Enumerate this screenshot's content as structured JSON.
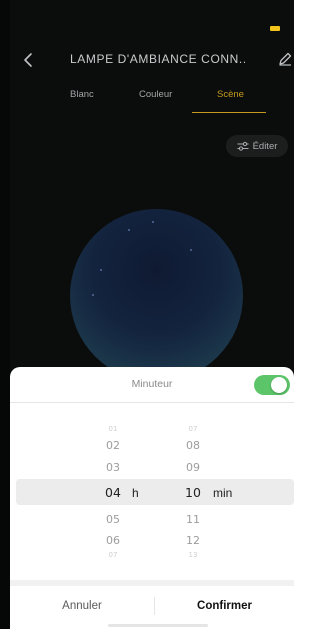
{
  "header": {
    "title": "LAMPE D'AMBIANCE CONN...",
    "back_icon": "chevron-left-icon",
    "edit_icon": "pencil-icon"
  },
  "status_bar": {
    "battery_color": "#f2c41c"
  },
  "tabs": [
    {
      "label": "Blanc",
      "active": false
    },
    {
      "label": "Couleur",
      "active": false
    },
    {
      "label": "Scène",
      "active": true
    }
  ],
  "accent_color": "#c49a1c",
  "editer_button": {
    "label": "Éditer",
    "icon": "sliders-icon"
  },
  "timer_sheet": {
    "title": "Minuteur",
    "toggle_on": true,
    "toggle_color": "#5cc56a",
    "hours": {
      "above": [
        "01",
        "02",
        "03"
      ],
      "selected": "04",
      "below": [
        "05",
        "06",
        "07"
      ],
      "unit": "h"
    },
    "minutes": {
      "above": [
        "07",
        "08",
        "09"
      ],
      "selected": "10",
      "below": [
        "11",
        "12",
        "13"
      ],
      "unit": "min"
    },
    "cancel_label": "Annuler",
    "confirm_label": "Confirmer"
  }
}
